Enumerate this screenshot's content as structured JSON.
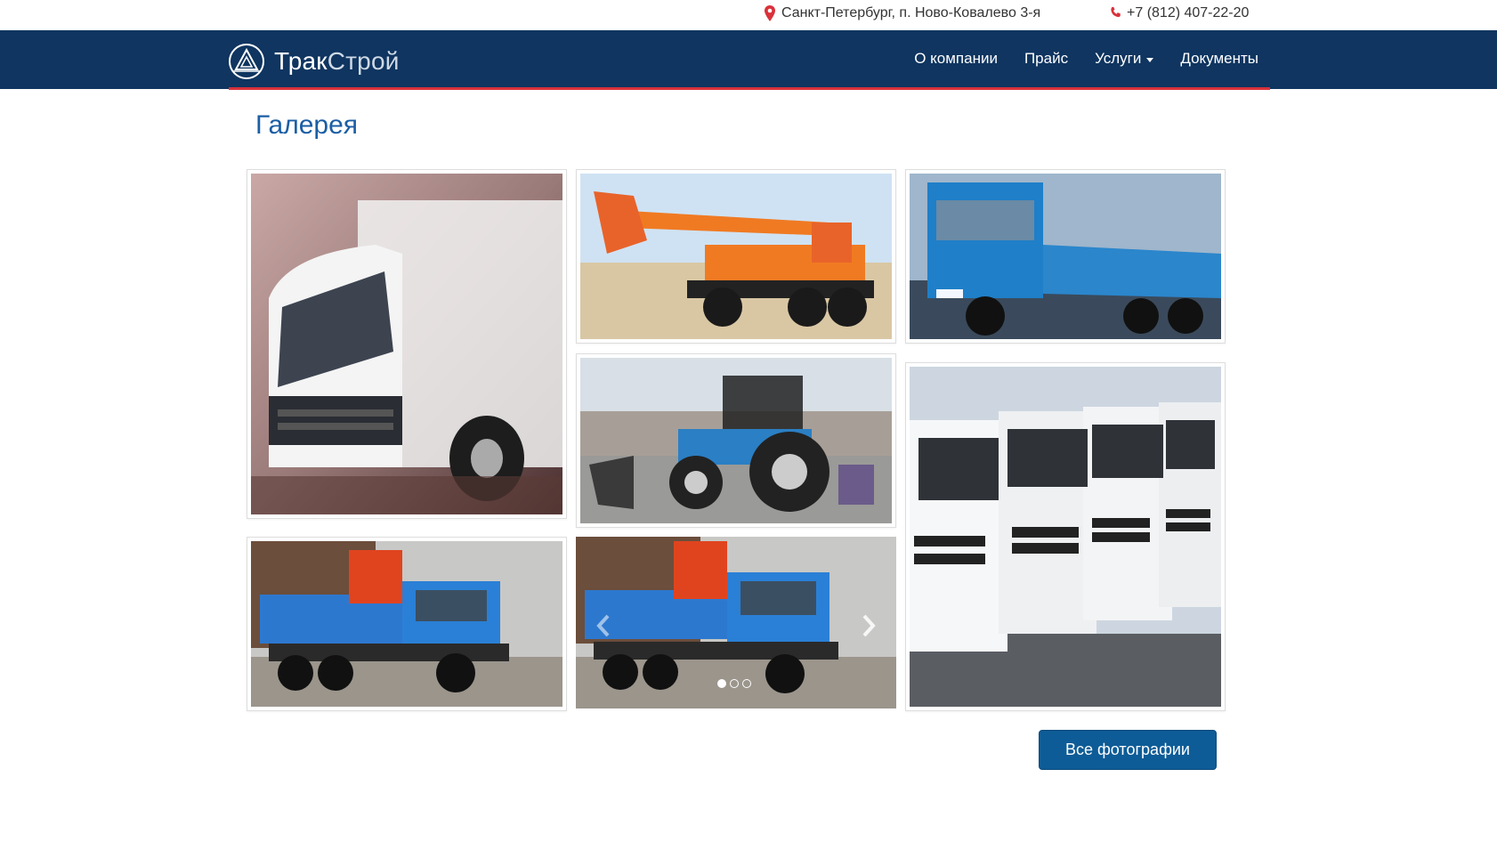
{
  "contact": {
    "address": "Санкт-Петербург, п. Ново-Ковалево 3-я",
    "phone": "+7 (812) 407-22-20",
    "address_icon": "map-pin-icon",
    "phone_icon": "phone-icon"
  },
  "brand": {
    "name_bold": "Трак",
    "name_light": "Строй",
    "logo_icon": "triangle-circle-logo-icon"
  },
  "nav": {
    "items": [
      {
        "label": "О компании"
      },
      {
        "label": "Прайс"
      },
      {
        "label": "Услуги",
        "has_dropdown": true
      },
      {
        "label": "Документы"
      }
    ]
  },
  "gallery": {
    "title": "Галерея",
    "carousel": {
      "slides": 3,
      "active_slide": 1
    },
    "all_photos_label": "Все фотографии"
  },
  "colors": {
    "navbar": "#0f3560",
    "accent_line": "#d9323b",
    "title": "#1b5ea5",
    "button": "#0d5c97"
  }
}
